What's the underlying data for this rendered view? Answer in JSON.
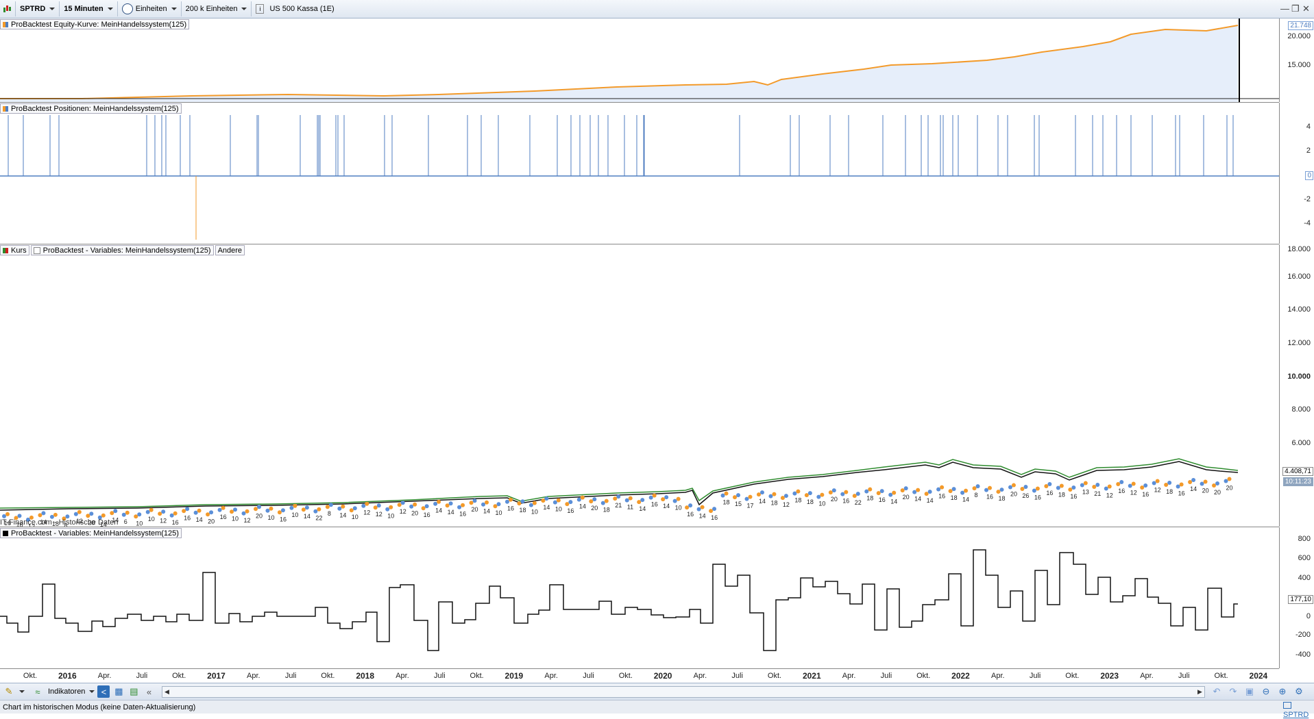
{
  "toolbar": {
    "symbol": "SPTRD",
    "timeframe": "15 Minuten",
    "units_mode": "Einheiten",
    "units_count": "200 k Einheiten",
    "instrument": "US 500 Kassa (1E)"
  },
  "panels": {
    "equity": {
      "legend": "ProBacktest Equity-Kurve: MeinHandelssystem(125)",
      "ticks": [
        "20.000",
        "15.000"
      ],
      "last_value": "21.748"
    },
    "positions": {
      "legend": "ProBacktest Positionen: MeinHandelssystem(125)",
      "ticks": [
        "4",
        "2",
        "-2",
        "-4"
      ],
      "last_value": "0"
    },
    "price": {
      "legend_items": [
        "Kurs",
        "ProBacktest - Variables: MeinHandelssystem(125)",
        "Andere"
      ],
      "ticks": [
        "18.000",
        "16.000",
        "14.000",
        "12.000",
        "10.000",
        "8.000",
        "6.000"
      ],
      "last_value": "4.408,71",
      "last_time": "10:11:23",
      "watermark": "IT-Finance.com - Historische Daten"
    },
    "variables": {
      "legend": "ProBacktest - Variables: MeinHandelssystem(125)",
      "ticks": [
        "800",
        "600",
        "400",
        "200",
        "0",
        "-200",
        "-400"
      ],
      "last_value": "177,10"
    }
  },
  "xaxis": {
    "labels": [
      "Okt.",
      "2016",
      "Apr.",
      "Juli",
      "Okt.",
      "2017",
      "Apr.",
      "Juli",
      "Okt.",
      "2018",
      "Apr.",
      "Juli",
      "Okt.",
      "2019",
      "Apr.",
      "Juli",
      "Okt.",
      "2020",
      "Apr.",
      "Juli",
      "Okt.",
      "2021",
      "Apr.",
      "Juli",
      "Okt.",
      "2022",
      "Apr.",
      "Juli",
      "Okt.",
      "2023",
      "Apr.",
      "Juli",
      "Okt.",
      "2024"
    ],
    "years": [
      "2016",
      "2017",
      "2018",
      "2019",
      "2020",
      "2021",
      "2022",
      "2023",
      "2024"
    ]
  },
  "bottombar": {
    "indicators": "Indikatoren",
    "symbol": "SPTRD"
  },
  "status": {
    "text": "Chart im historischen Modus (keine Daten-Aktualisierung)"
  },
  "colors": {
    "equity_fill": "#e6eefa",
    "equity_line": "#f39a2a",
    "position_line": "#4f7ec0",
    "short_line": "#f39a2a",
    "price_up": "#2e8b2e",
    "price_down": "#cc2020",
    "marker_buy": "#5b8fd8",
    "marker_sell": "#f39a2a"
  },
  "price_labels": [
    "16",
    "16",
    "12",
    "14",
    "18",
    "8",
    "12",
    "20",
    "14",
    "14",
    "6",
    "10",
    "10",
    "12",
    "16",
    "16",
    "14",
    "20",
    "16",
    "10",
    "12",
    "20",
    "10",
    "16",
    "10",
    "14",
    "22",
    "8",
    "14",
    "10",
    "12",
    "12",
    "10",
    "12",
    "20",
    "16",
    "14",
    "14",
    "16",
    "20",
    "14",
    "10",
    "16",
    "18",
    "10",
    "14",
    "10",
    "16",
    "14",
    "20",
    "18",
    "21",
    "11",
    "14",
    "16",
    "14",
    "10",
    "16",
    "14",
    "16",
    "18",
    "15",
    "17",
    "14",
    "18",
    "12",
    "18",
    "18",
    "10",
    "20",
    "16",
    "22",
    "18",
    "16",
    "14",
    "20",
    "14",
    "14",
    "16",
    "18",
    "14",
    "8",
    "16",
    "18",
    "20",
    "26",
    "16",
    "16",
    "18",
    "16",
    "13",
    "21",
    "12",
    "16",
    "12",
    "16",
    "12",
    "18",
    "16",
    "14",
    "20",
    "20",
    "20"
  ]
}
